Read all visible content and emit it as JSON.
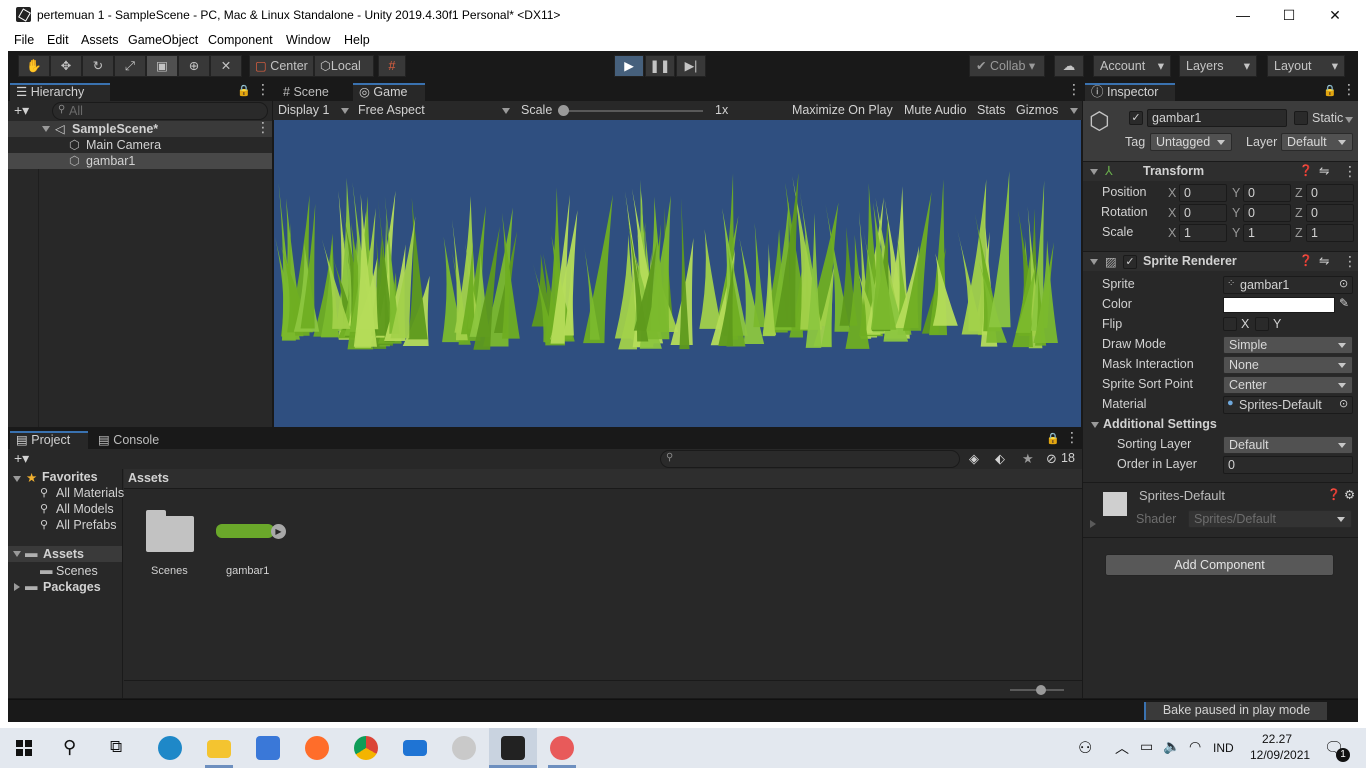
{
  "window": {
    "title": "pertemuan 1 - SampleScene - PC, Mac & Linux Standalone - Unity 2019.4.30f1 Personal* <DX11>",
    "minimize": "—",
    "maximize": "☐",
    "close": "✕"
  },
  "menu": [
    "File",
    "Edit",
    "Assets",
    "GameObject",
    "Component",
    "Window",
    "Help"
  ],
  "toolbar": {
    "pivot": "Center",
    "space": "Local",
    "collab": "Collab",
    "account": "Account",
    "layers": "Layers",
    "layout": "Layout"
  },
  "hierarchy": {
    "tab": "Hierarchy",
    "search_placeholder": "All",
    "scene": "SampleScene*",
    "items": [
      "Main Camera",
      "gambar1"
    ]
  },
  "game": {
    "tabs": [
      "Scene",
      "Game"
    ],
    "display": "Display 1",
    "aspect": "Free Aspect",
    "scale_label": "Scale",
    "scale_value": "1x",
    "options": [
      "Maximize On Play",
      "Mute Audio",
      "Stats",
      "Gizmos"
    ],
    "background": "#2f4f80"
  },
  "project": {
    "tabs": [
      "Project",
      "Console"
    ],
    "hidden_count": "18",
    "favorites_label": "Favorites",
    "favorites": [
      "All Materials",
      "All Models",
      "All Prefabs"
    ],
    "assets_label": "Assets",
    "assets_children": [
      "Scenes"
    ],
    "packages_label": "Packages",
    "breadcrumb": "Assets",
    "grid_items": [
      {
        "name": "Scenes",
        "icon": "folder-icon"
      },
      {
        "name": "gambar1",
        "icon": "grass-sprite-thumbnail"
      }
    ]
  },
  "inspector": {
    "tab": "Inspector",
    "object_name": "gambar1",
    "static_label": "Static",
    "tag_label": "Tag",
    "tag_value": "Untagged",
    "layer_label": "Layer",
    "layer_value": "Default",
    "transform": {
      "title": "Transform",
      "rows": [
        {
          "label": "Position",
          "x": "0",
          "y": "0",
          "z": "0"
        },
        {
          "label": "Rotation",
          "x": "0",
          "y": "0",
          "z": "0"
        },
        {
          "label": "Scale",
          "x": "1",
          "y": "1",
          "z": "1"
        }
      ]
    },
    "sprite_renderer": {
      "title": "Sprite Renderer",
      "sprite_label": "Sprite",
      "sprite_value": "gambar1",
      "color_label": "Color",
      "flip_label": "Flip",
      "flip_x": "X",
      "flip_y": "Y",
      "draw_mode_label": "Draw Mode",
      "draw_mode_value": "Simple",
      "mask_label": "Mask Interaction",
      "mask_value": "None",
      "sort_point_label": "Sprite Sort Point",
      "sort_point_value": "Center",
      "material_label": "Material",
      "material_value": "Sprites-Default",
      "additional_label": "Additional Settings",
      "sorting_layer_label": "Sorting Layer",
      "sorting_layer_value": "Default",
      "order_label": "Order in Layer",
      "order_value": "0"
    },
    "material": {
      "name": "Sprites-Default",
      "shader_label": "Shader",
      "shader_value": "Sprites/Default"
    },
    "add_component": "Add Component"
  },
  "status": {
    "message": "Bake paused in play mode"
  },
  "taskbar": {
    "lang": "IND",
    "time": "22.27",
    "date": "12/09/2021",
    "notifications": "1"
  }
}
